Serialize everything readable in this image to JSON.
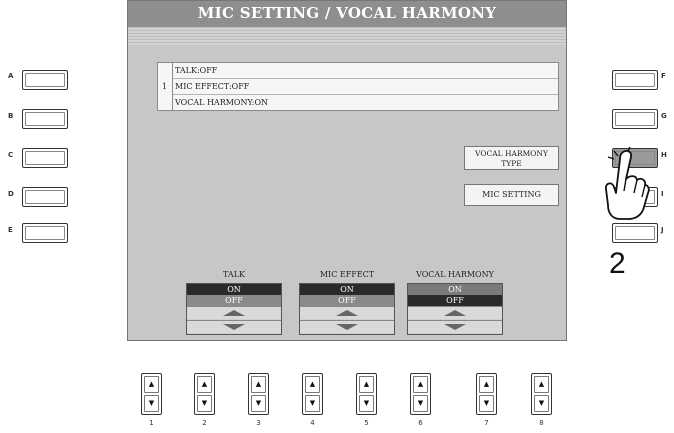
{
  "screen": {
    "title": "MIC SETTING / VOCAL HARMONY",
    "list": {
      "index": "1",
      "rows": [
        "TALK:OFF",
        "MIC EFFECT:OFF",
        "VOCAL HARMONY:ON"
      ]
    },
    "vocal_harmony_type_line1": "VOCAL HARMONY",
    "vocal_harmony_type_line2": "TYPE",
    "mic_setting_label": "MIC SETTING",
    "controls": [
      {
        "label": "TALK",
        "opt_top": "ON",
        "opt_bottom": "OFF"
      },
      {
        "label": "MIC EFFECT",
        "opt_top": "ON",
        "opt_bottom": "OFF"
      },
      {
        "label": "VOCAL HARMONY",
        "opt_top": "ON",
        "opt_bottom": "OFF"
      }
    ]
  },
  "left_buttons": [
    "A",
    "B",
    "C",
    "D",
    "E"
  ],
  "right_buttons": [
    "F",
    "G",
    "H",
    "I",
    "J"
  ],
  "bottom_buttons": {
    "numbers": [
      "1",
      "2",
      "3",
      "4",
      "5",
      "6",
      "7",
      "8"
    ],
    "up": "▲",
    "down": "▼"
  },
  "step_number": "2",
  "icons": {
    "finger": "pointing-hand-icon",
    "up": "triangle-up-icon",
    "down": "triangle-down-icon"
  }
}
